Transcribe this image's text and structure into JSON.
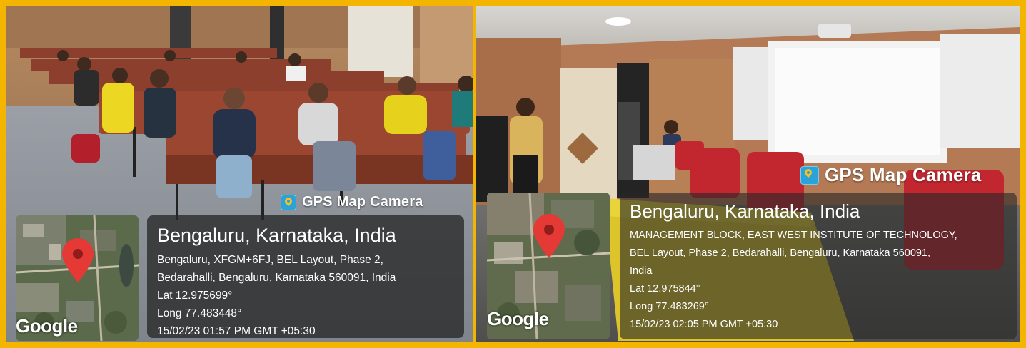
{
  "photos": [
    {
      "overlay": {
        "brand": "GPS Map Camera",
        "map_watermark": "Google",
        "city": "Bengaluru, Karnataka, India",
        "address_lines": [
          "Bengaluru, XFGM+6FJ, BEL Layout, Phase 2,",
          "Bedarahalli, Bengaluru, Karnataka 560091, India"
        ],
        "lat": "Lat 12.975699°",
        "long": "Long 77.483448°",
        "datetime": "15/02/23 01:57 PM GMT +05:30"
      }
    },
    {
      "overlay": {
        "brand": "GPS Map Camera",
        "map_watermark": "Google",
        "city": "Bengaluru, Karnataka, India",
        "address_lines": [
          "MANAGEMENT BLOCK, EAST WEST INSTITUTE OF TECHNOLOGY,",
          "BEL Layout, Phase 2, Bedarahalli, Bengaluru, Karnataka 560091,",
          "India"
        ],
        "lat": "Lat 12.975844°",
        "long": "Long 77.483269°",
        "datetime": "15/02/23 02:05 PM GMT +05:30"
      }
    }
  ],
  "colors": {
    "border": "#f4b500",
    "card_bg": "#282828",
    "map_pin": "#e53935",
    "badge": "#2aa4d8"
  },
  "icons": [
    "map-pin-icon",
    "gps-camera-icon"
  ]
}
